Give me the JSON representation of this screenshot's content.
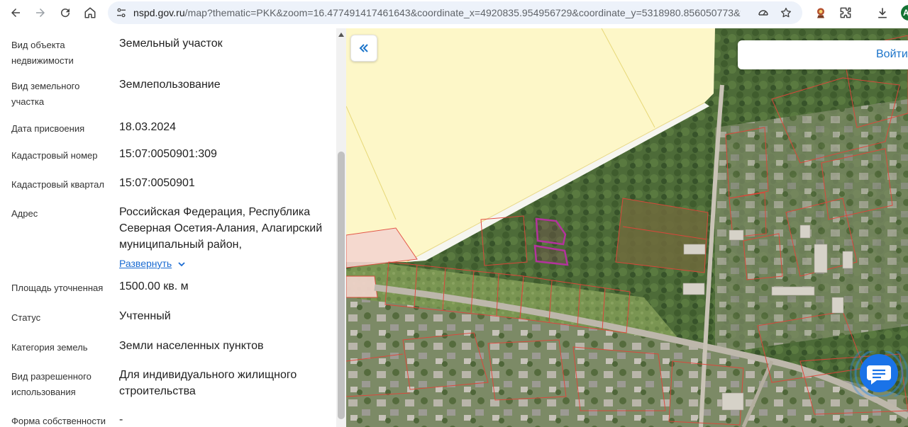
{
  "browser": {
    "url_host": "nspd.gov.ru",
    "url_rest": "/map?thematic=PKK&zoom=16.477491417461643&coordinate_x=4920835.954956729&coordinate_y=5318980.856050773&the...",
    "profile_initial": "A"
  },
  "panel": {
    "rows": [
      {
        "key": "Вид объекта недвижимости",
        "value": "Земельный участок"
      },
      {
        "key": "Вид земельного участка",
        "value": "Землепользование"
      },
      {
        "key": "Дата присвоения",
        "value": "18.03.2024"
      },
      {
        "key": "Кадастровый номер",
        "value": "15:07:0050901:309"
      },
      {
        "key": "Кадастровый квартал",
        "value": "15:07:0050901"
      },
      {
        "key": "Адрес",
        "value": "Российская Федерация, Республика Северная Осетия-Алания, Алагирский муниципальный район,",
        "expand_label": "Развернуть"
      },
      {
        "key": "Площадь уточненная",
        "value": "1500.00 кв. м"
      },
      {
        "key": "Статус",
        "value": "Учтенный"
      },
      {
        "key": "Категория земель",
        "value": "Земли населенных пунктов"
      },
      {
        "key": "Вид разрешенного использования",
        "value": "Для индивидуального жилищного строительства"
      },
      {
        "key": "Форма собственности",
        "value": "-"
      }
    ]
  },
  "map": {
    "login_label": "Войти",
    "colors": {
      "parcel_outline": "#e0453a",
      "selected_parcel": "#b3339c",
      "farmland": "#fdf7c8",
      "accent": "#1a73c9"
    }
  }
}
